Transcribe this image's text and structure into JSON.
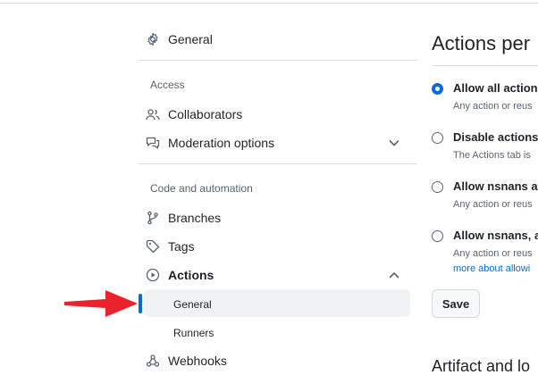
{
  "sidebar": {
    "general_label": "General",
    "access_heading": "Access",
    "collaborators_label": "Collaborators",
    "moderation_label": "Moderation options",
    "code_heading": "Code and automation",
    "branches_label": "Branches",
    "tags_label": "Tags",
    "actions_label": "Actions",
    "actions_sub": {
      "general": "General",
      "runners": "Runners"
    },
    "webhooks_label": "Webhooks"
  },
  "main": {
    "title": "Actions per",
    "options": [
      {
        "label": "Allow all action",
        "desc": "Any action or reus",
        "checked": true
      },
      {
        "label": "Disable actions",
        "desc": "The Actions tab is",
        "checked": false
      },
      {
        "label": "Allow nsnans a",
        "desc": "Any action or reus",
        "checked": false
      },
      {
        "label": "Allow nsnans, a",
        "desc": "Any action or reus",
        "link": "more about allowi",
        "checked": false
      }
    ],
    "save_label": "Save",
    "next_section": "Artifact and lo"
  },
  "colors": {
    "accent": "#0969da",
    "arrow": "#e8232b"
  }
}
